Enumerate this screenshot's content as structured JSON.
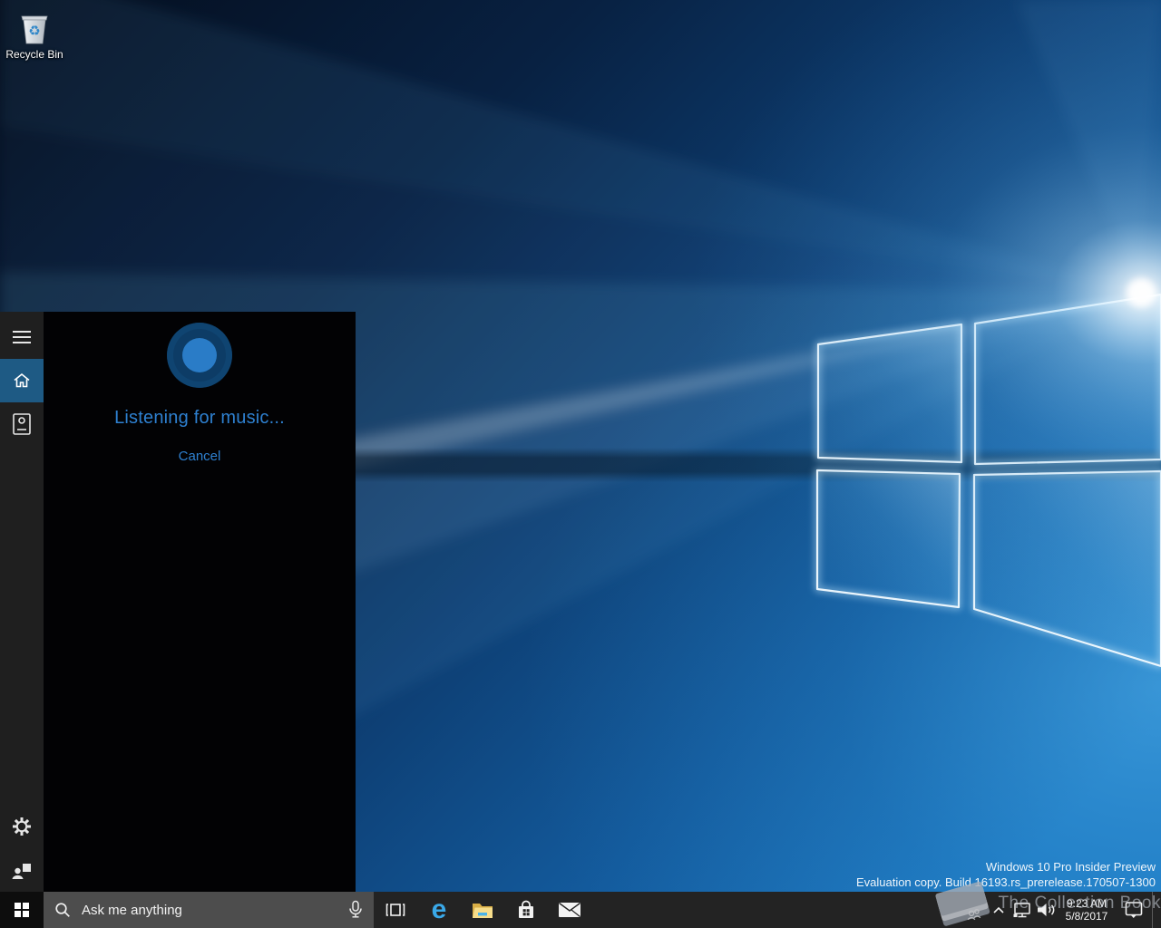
{
  "desktop": {
    "recycle_bin": {
      "label": "Recycle Bin"
    }
  },
  "cortana": {
    "listening_text": "Listening for music...",
    "cancel_label": "Cancel",
    "rail_icons": [
      "hamburger-menu",
      "home",
      "notebook",
      "settings-gear",
      "send-feedback"
    ]
  },
  "taskbar": {
    "search": {
      "placeholder": "Ask me anything"
    },
    "app_icons": [
      "task-view",
      "edge-browser",
      "file-explorer",
      "windows-store",
      "mail"
    ],
    "tray_icons": [
      "hidden-icons-chevron",
      "network",
      "volume",
      "action-center"
    ],
    "clock": {
      "time": "9:23 AM",
      "date": "5/8/2017"
    }
  },
  "watermarks": {
    "windows": {
      "line1": "Windows 10 Pro Insider Preview",
      "line2": "Evaluation copy. Build 16193.rs_prerelease.170507-1300"
    },
    "collection": {
      "text": "The Collection Book"
    }
  },
  "icons": {
    "edge_glyph": "e",
    "recycle_glyph": "♻"
  },
  "theme": {
    "accent_text_blue": "#2e80d0",
    "cortana_active_bg": "#1e5a84",
    "cortana_outer_circle": "#0d3c66",
    "cortana_inner_circle": "#2a7cc7",
    "taskbar_bg": "#232323",
    "search_box_bg": "#4d4d4d",
    "edge_blue": "#3aa9e9",
    "folder_yellow": "#f3cf66"
  }
}
